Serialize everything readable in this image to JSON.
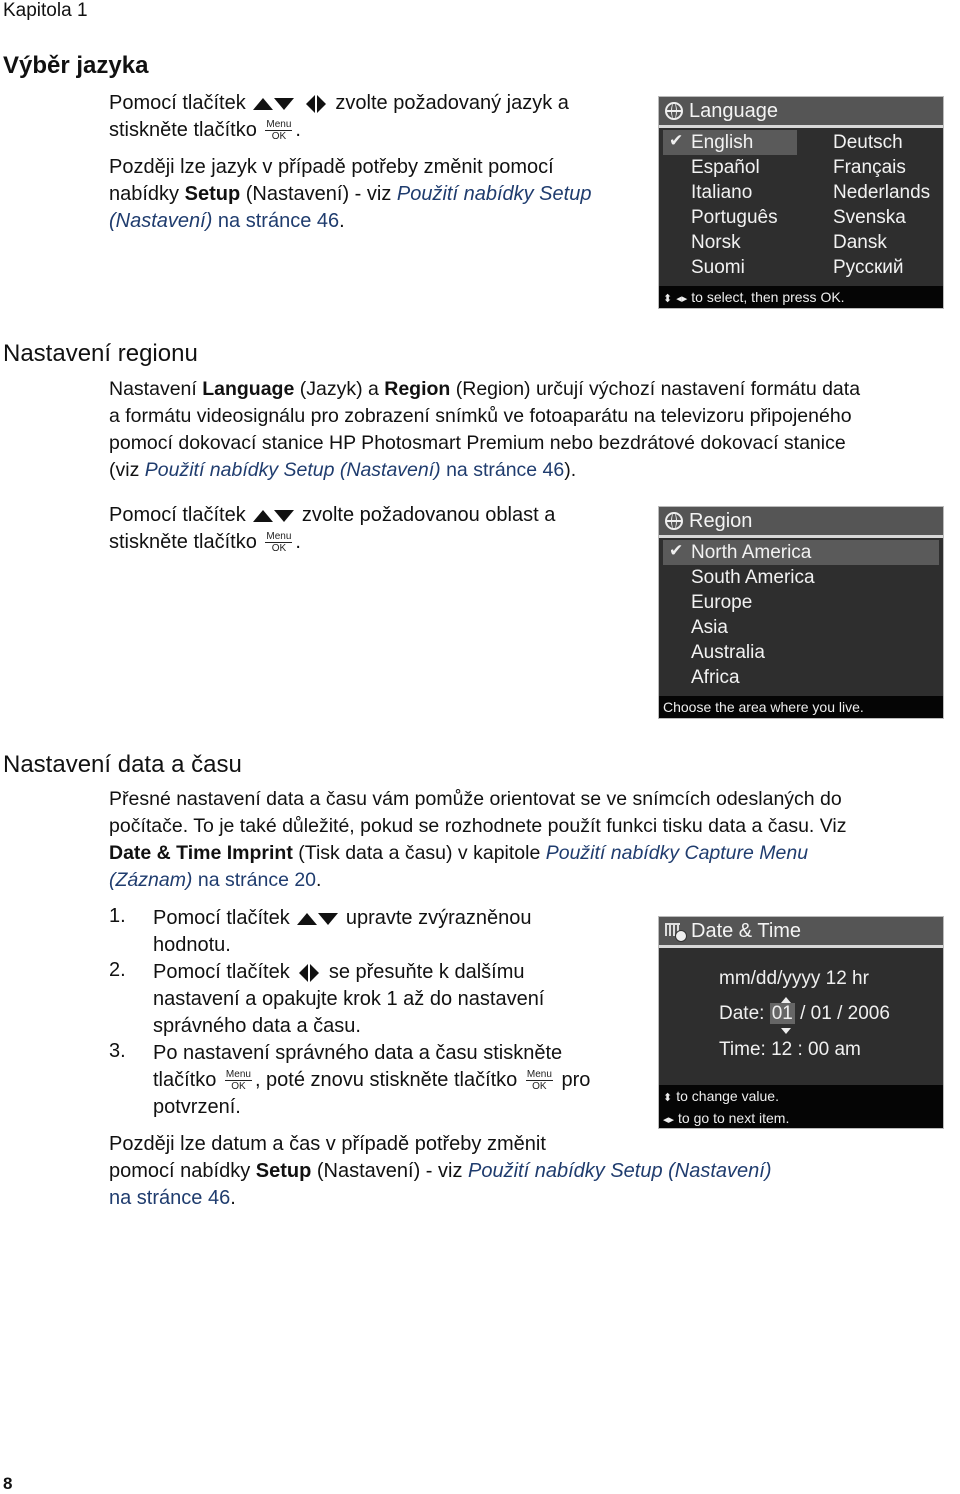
{
  "header": {
    "chapter": "Kapitola 1"
  },
  "footer": {
    "page_number": "8"
  },
  "section1": {
    "title": "Výběr jazyka",
    "p1_a": "Pomocí tlačítek",
    "p1_b": "zvolte požadovaný jazyk a",
    "p1_c": "stiskněte tlačítko",
    "p1_d": ".",
    "p2_a": "Později lze jazyk v případě potřeby změnit pomocí",
    "p2_b": "nabídky ",
    "p2_bold": "Setup",
    "p2_c": " (Nastavení) - viz ",
    "p2_link1": "Použití nabídky Setup",
    "p2_link2": "(Nastavení)",
    "p2_link3": " na stránce 46",
    "p2_end": "."
  },
  "language_screen": {
    "title": "Language",
    "left_options": [
      "English",
      "Español",
      "Italiano",
      "Português",
      "Norsk",
      "Suomi"
    ],
    "right_options": [
      "Deutsch",
      "Français",
      "Nederlands",
      "Svenska",
      "Dansk",
      "Русский"
    ],
    "selected": "English",
    "footer": "to select, then press OK."
  },
  "section2": {
    "title": "Nastavení regionu",
    "p1_l1_a": "Nastavení ",
    "p1_l1_b1": "Language",
    "p1_l1_c": " (Jazyk) a ",
    "p1_l1_b2": "Region",
    "p1_l1_d": " (Region) určují výchozí nastavení formátu data",
    "p1_l2": "a formátu videosignálu pro zobrazení snímků ve fotoaparátu na televizoru připojeného",
    "p1_l3": "pomocí dokovací stanice HP Photosmart Premium nebo bezdrátové dokovací stanice",
    "p1_l4_a": "(viz ",
    "p1_l4_link": "Použití nabídky Setup (Nastavení)",
    "p1_l4_link2": " na stránce 46",
    "p1_l4_end": ").",
    "p2_a": "Pomocí tlačítek",
    "p2_b": "zvolte požadovanou oblast a",
    "p2_c": "stiskněte tlačítko",
    "p2_d": "."
  },
  "region_screen": {
    "title": "Region",
    "options": [
      "North America",
      "South America",
      "Europe",
      "Asia",
      "Australia",
      "Africa"
    ],
    "selected": "North America",
    "footer": "Choose the area where you live."
  },
  "section3": {
    "title": "Nastavení data a času",
    "p1_l1": "Přesné nastavení data a času vám pomůže orientovat se ve snímcích odeslaných do",
    "p1_l2": "počítače. To je také důležité, pokud se rozhodnete použít funkci tisku data a času. Viz",
    "p1_l3_bold": "Date & Time Imprint",
    "p1_l3_a": " (Tisk data a času) v kapitole ",
    "p1_l3_link": "Použití nabídky Capture Menu",
    "p1_l4_link": "(Záznam)",
    "p1_l4_link2": " na stránce 20",
    "p1_l4_end": ".",
    "steps": [
      {
        "num": "1.",
        "a": "Pomocí tlačítek",
        "b": "upravte zvýrazněnou",
        "c": "hodnotu."
      },
      {
        "num": "2.",
        "a": "Pomocí tlačítek",
        "b": "se přesuňte k dalšímu",
        "c": "nastavení a opakujte krok 1 až do nastavení",
        "d": "správného data a času."
      },
      {
        "num": "3.",
        "a": "Po nastavení správného data a času stiskněte",
        "b": "tlačítko",
        "c": ", poté znovu stiskněte tlačítko",
        "d": "pro",
        "e": "potvrzení."
      }
    ],
    "p2_l1": "Později lze datum a čas v případě potřeby změnit",
    "p2_l2_a": "pomocí nabídky ",
    "p2_l2_bold": "Setup",
    "p2_l2_b": " (Nastavení) - viz ",
    "p2_l2_link": "Použití nabídky Setup (Nastavení)",
    "p2_l3_link": "na stránce 46",
    "p2_l3_end": "."
  },
  "datetime_screen": {
    "title": "Date & Time",
    "format": "mm/dd/yyyy  12 hr",
    "date_label": "Date:",
    "date_month": "01",
    "date_rest": "/ 01 / 2006",
    "time_label": "Time:",
    "time_value": "12 : 00  am",
    "footer1": "to change value.",
    "footer2": "to go to next item."
  },
  "button_label": {
    "menu": "Menu",
    "ok": "OK"
  }
}
